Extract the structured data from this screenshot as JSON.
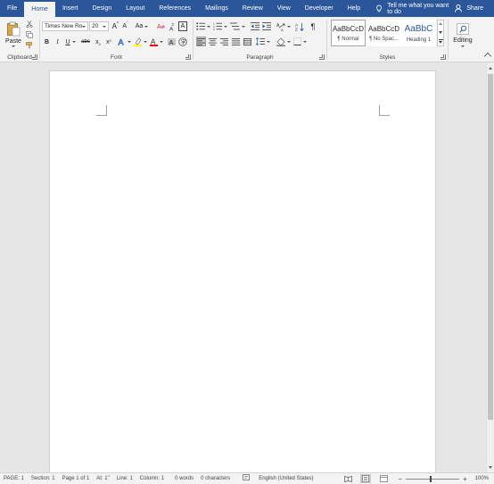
{
  "tabs": [
    "File",
    "Home",
    "Insert",
    "Design",
    "Layout",
    "References",
    "Mailings",
    "Review",
    "View",
    "Developer",
    "Help"
  ],
  "active_tab": "Home",
  "tell_me": "Tell me what you want to do",
  "share": "Share",
  "clipboard": {
    "label": "Clipboard",
    "paste": "Paste"
  },
  "font": {
    "label": "Font",
    "name": "Times New Ro",
    "size": "20",
    "grow": "A",
    "shrink": "A",
    "case": "Aa",
    "bold": "B",
    "italic": "I",
    "underline": "U",
    "strike": "abc",
    "subscript": "x",
    "superscript": "x",
    "font_color": "A",
    "text_effects": "A",
    "char_border": "A"
  },
  "paragraph": {
    "label": "Paragraph",
    "pilcrow": "¶"
  },
  "styles": {
    "label": "Styles",
    "items": [
      {
        "sample": "AaBbCcD",
        "name": "¶ Normal"
      },
      {
        "sample": "AaBbCcD",
        "name": "¶ No Spac..."
      },
      {
        "sample": "AaBbC",
        "name": "Heading 1"
      }
    ]
  },
  "editing": {
    "label": "Editing"
  },
  "status": {
    "page": "PAGE: 1",
    "section": "Section: 1",
    "page_of": "Page 1 of 1",
    "at": "At: 1\"",
    "line": "Line: 1",
    "column": "Column: 1",
    "words": "0 words",
    "characters": "0 characters",
    "language": "English (United States)",
    "zoom_minus": "−",
    "zoom_plus": "+",
    "zoom": "100%"
  },
  "colors": {
    "brand": "#2b579a",
    "highlight": "#ffff00",
    "font_color": "#ff0000",
    "heading_blue": "#2f5496"
  }
}
